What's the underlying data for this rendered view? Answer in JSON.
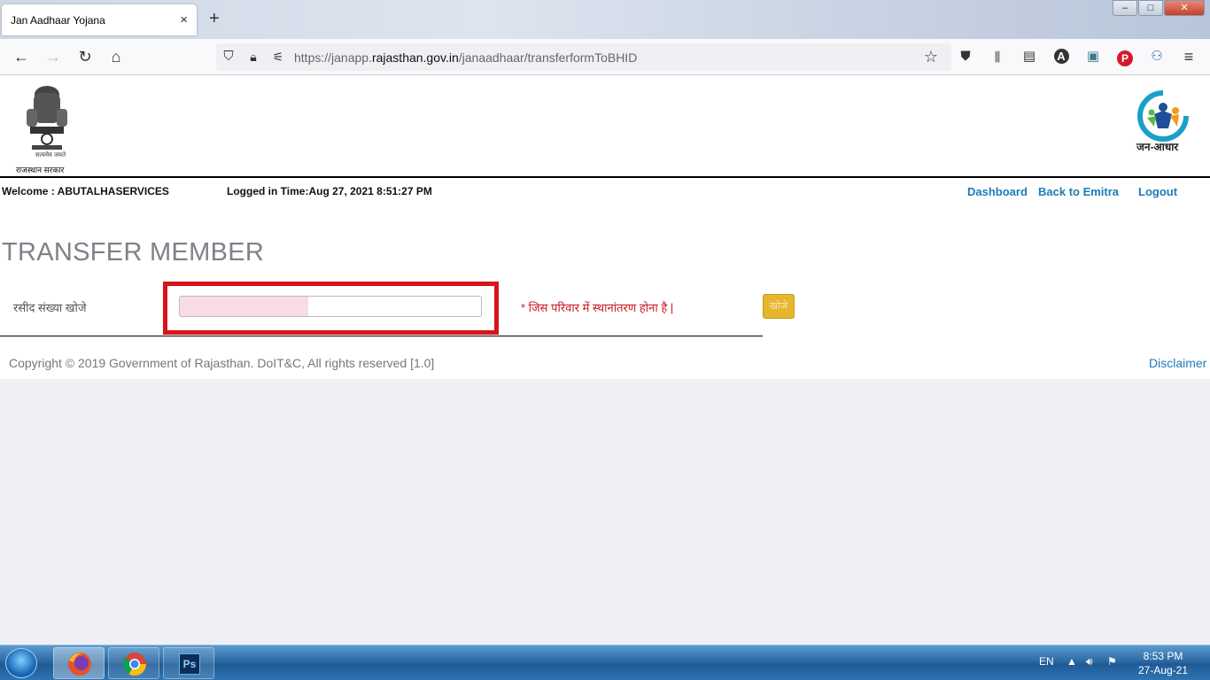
{
  "browser": {
    "tab_title": "Jan Aadhaar Yojana",
    "tab_close": "×",
    "new_tab": "+",
    "url_prefix": "https://janapp.",
    "url_domain": "rajasthan.gov.in",
    "url_path": "/janaadhaar/transferformToBHID"
  },
  "header": {
    "emblem_caption_top": "सत्यमेव जयते",
    "emblem_caption_bottom": "राजस्थान सरकार",
    "logo_caption": "जन-आधार"
  },
  "userbar": {
    "welcome": "Welcome : ABUTALHASERVICES",
    "logged_in": "Logged in Time:Aug 27, 2021 8:51:27 PM",
    "links": [
      "Dashboard",
      "Back to Emitra",
      "Logout"
    ]
  },
  "main": {
    "title": "TRANSFER MEMBER",
    "search_label": "रसीद संख्या खोजे",
    "search_value": "",
    "hint": "* जिस परिवार में स्थानांतरण होना है |",
    "search_button": "खोजे"
  },
  "footer": {
    "copyright": "Copyright © 2019 Government of Rajasthan. DoIT&C, All rights reserved [1.0]",
    "disclaimer": "Disclaimer"
  },
  "taskbar": {
    "language": "EN",
    "time": "8:53 PM",
    "date": "27-Aug-21",
    "apps": [
      "firefox",
      "chrome",
      "photoshop"
    ],
    "ps_label": "Ps"
  }
}
